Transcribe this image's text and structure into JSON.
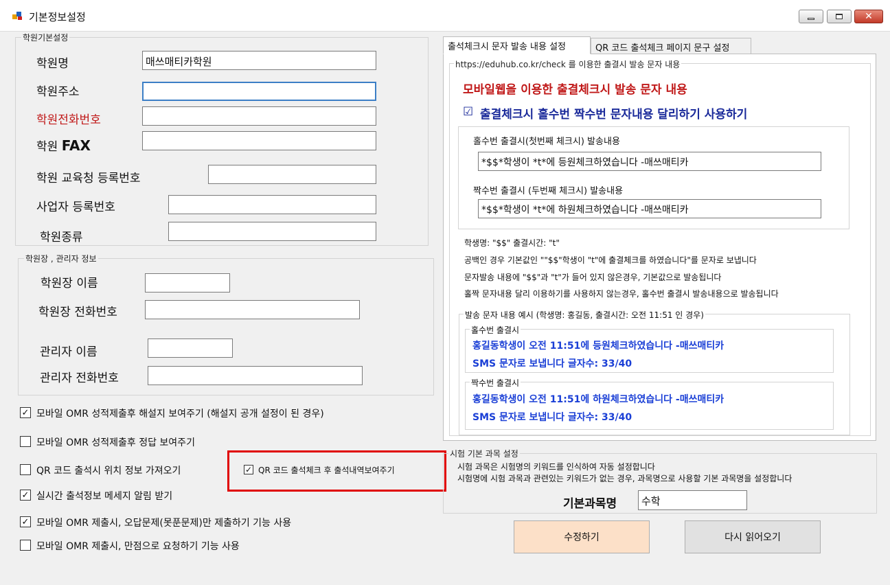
{
  "window": {
    "title": "기본정보설정"
  },
  "academy_basic": {
    "legend": "학원기본설정",
    "name_label": "학원명",
    "name_value": "매쓰매티카학원",
    "address_label": "학원주소",
    "address_value": "",
    "phone_label": "학원전화번호",
    "phone_value": "",
    "fax_label_prefix": "학원",
    "fax_label_suffix": "FAX",
    "fax_value": "",
    "edu_reg_label": "학원 교육청 등록번호",
    "edu_reg_value": "",
    "biz_reg_label": "사업자 등록번호",
    "biz_reg_value": "",
    "type_label": "학원종류",
    "type_value": ""
  },
  "director_info": {
    "legend": "학원장 , 관리자 정보",
    "director_name_label": "학원장 이름",
    "director_phone_label": "학원장 전화번호",
    "manager_name_label": "관리자 이름",
    "manager_phone_label": "관리자 전화번호"
  },
  "options": [
    {
      "label": "모바일 OMR 성적제출후 해설지 보여주기 (해설지 공개 설정이 된 경우)",
      "checked": true
    },
    {
      "label": "모바일 OMR 성적제출후 정답 보여주기",
      "checked": false
    },
    {
      "label": "QR 코드 출석시 위치 정보 가져오기",
      "checked": false
    },
    {
      "label": "실시간 출석정보 메세지 알림 받기",
      "checked": true
    },
    {
      "label": "모바일 OMR 제출시, 오답문제(못푼문제)만 제출하기 기능 사용",
      "checked": true
    },
    {
      "label": "모바일 OMR 제출시, 만점으로 요청하기 기능 사용",
      "checked": false
    }
  ],
  "qr_history_option": {
    "label": "QR 코드 출석체크 후 출석내역보여주기",
    "checked": true
  },
  "tabs": [
    {
      "label": "출석체크시 문자 발송 내용 설정"
    },
    {
      "label": "QR 코드 출석체크 페이지 문구 설정"
    }
  ],
  "sms": {
    "legend": "https://eduhub.co.kr/check 를 이용한 출결시 발송 문자 내용",
    "heading": "모바일웹을 이용한 출결체크시 발송 문자 내용",
    "odd_even_option": {
      "label": "출결체크시 홀수번 짝수번 문자내용 달리하기 사용하기",
      "checked": true
    },
    "odd_label": "홀수번 출결시(첫번째 체크시) 발송내용",
    "odd_value": "*$$*학생이 *t*에 등원체크하였습니다 -매쓰매티카",
    "even_label": "짝수번 출결시 (두번째 체크시) 발송내용",
    "even_value": "*$$*학생이 *t*에 하원체크하였습니다 -매쓰매티카",
    "help_lines": [
      "학생명:  \"$$\"   출결시간: \"t\"",
      "공백인 경우 기본값인 \"\"$$\"학생이 \"t\"에 출결체크를 하였습니다\"를 문자로 보냅니다",
      "문자발송 내용에 \"$$\"과 \"t\"가 들어 있지 않은경우, 기본값으로 발송됩니다",
      "홀짝 문자내용 달리 이용하기를 사용하지 않는경우, 홀수번 출결시 발송내용으로 발송됩니다"
    ],
    "example_legend": "발송 문자 내용 예시 (학생명: 홍길동, 출결시간: 오전 11:51 인 경우)",
    "example_odd_legend": "홀수번 출결시",
    "example_odd_text": "홍길동학생이 오전 11:51에 등원체크하였습니다 -매쓰매티카",
    "example_odd_count": "SMS 문자로 보냅니다 글자수: 33/40",
    "example_even_legend": "짝수번 출결시",
    "example_even_text": "홍길동학생이 오전 11:51에 하원체크하였습니다 -매쓰매티카",
    "example_even_count": "SMS 문자로 보냅니다 글자수: 33/40"
  },
  "exam_subject": {
    "legend": "시험 기본 과목 설정",
    "line1": "시험 과목은 시험명의 키워드를 인식하여 자동 설정합니다",
    "line2": "시험명에 시험 과목과 관련있는 키워드가 없는 경우, 과목명으로 사용할 기본 과목명을 설정합니다",
    "default_label": "기본과목명",
    "default_value": "수학"
  },
  "buttons": {
    "save": "수정하기",
    "reload": "다시 읽어오기"
  },
  "colors": {
    "red_label": "#c01818",
    "blue_text": "#1a3fd6",
    "save_button": "#fce0c8",
    "highlight_box": "#e00000"
  }
}
